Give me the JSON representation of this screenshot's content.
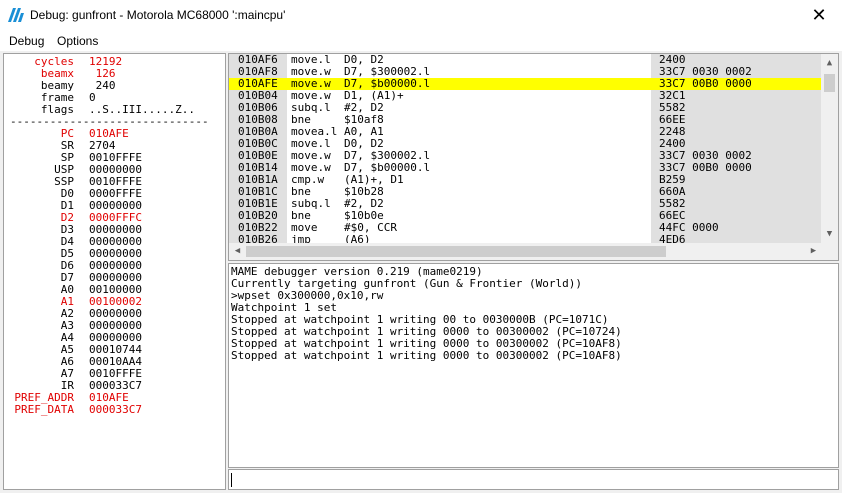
{
  "window": {
    "title": "Debug: gunfront - Motorola MC68000 ':maincpu'"
  },
  "menu": [
    "Debug",
    "Options"
  ],
  "colors": {
    "changed": "#e00000",
    "highlight": "#ffff00",
    "shade": "#e0e0e0"
  },
  "registers": [
    {
      "name": "cycles",
      "value": "12192",
      "changed": true
    },
    {
      "name": "beamx",
      "value": " 126",
      "changed": true
    },
    {
      "name": "beamy",
      "value": " 240",
      "changed": false
    },
    {
      "name": "frame",
      "value": "0",
      "changed": false
    },
    {
      "name": "flags",
      "value": "..S..III.....Z..",
      "changed": false
    },
    {
      "name": "PC",
      "value": "010AFE",
      "changed": true
    },
    {
      "name": "SR",
      "value": "2704",
      "changed": false
    },
    {
      "name": "SP",
      "value": "0010FFFE",
      "changed": false
    },
    {
      "name": "USP",
      "value": "00000000",
      "changed": false
    },
    {
      "name": "SSP",
      "value": "0010FFFE",
      "changed": false
    },
    {
      "name": "D0",
      "value": "0000FFFE",
      "changed": false
    },
    {
      "name": "D1",
      "value": "00000000",
      "changed": false
    },
    {
      "name": "D2",
      "value": "0000FFFC",
      "changed": true
    },
    {
      "name": "D3",
      "value": "00000000",
      "changed": false
    },
    {
      "name": "D4",
      "value": "00000000",
      "changed": false
    },
    {
      "name": "D5",
      "value": "00000000",
      "changed": false
    },
    {
      "name": "D6",
      "value": "00000000",
      "changed": false
    },
    {
      "name": "D7",
      "value": "00000000",
      "changed": false
    },
    {
      "name": "A0",
      "value": "00100000",
      "changed": false
    },
    {
      "name": "A1",
      "value": "00100002",
      "changed": true
    },
    {
      "name": "A2",
      "value": "00000000",
      "changed": false
    },
    {
      "name": "A3",
      "value": "00000000",
      "changed": false
    },
    {
      "name": "A4",
      "value": "00000000",
      "changed": false
    },
    {
      "name": "A5",
      "value": "00010744",
      "changed": false
    },
    {
      "name": "A6",
      "value": "00010AA4",
      "changed": false
    },
    {
      "name": "A7",
      "value": "0010FFFE",
      "changed": false
    },
    {
      "name": "IR",
      "value": "000033C7",
      "changed": false
    },
    {
      "name": "PREF_ADDR",
      "value": "010AFE",
      "changed": true
    },
    {
      "name": "PREF_DATA",
      "value": "000033C7",
      "changed": true
    }
  ],
  "separator": "------------------------------",
  "disassembly": [
    {
      "addr": "010AF6",
      "instr": "move.l  D0, D2",
      "bytes": "2400",
      "current": false
    },
    {
      "addr": "010AF8",
      "instr": "move.w  D7, $300002.l",
      "bytes": "33C7 0030 0002",
      "current": false
    },
    {
      "addr": "010AFE",
      "instr": "move.w  D7, $b00000.l",
      "bytes": "33C7 00B0 0000",
      "current": true
    },
    {
      "addr": "010B04",
      "instr": "move.w  D1, (A1)+",
      "bytes": "32C1",
      "current": false
    },
    {
      "addr": "010B06",
      "instr": "subq.l  #2, D2",
      "bytes": "5582",
      "current": false
    },
    {
      "addr": "010B08",
      "instr": "bne     $10af8",
      "bytes": "66EE",
      "current": false
    },
    {
      "addr": "010B0A",
      "instr": "movea.l A0, A1",
      "bytes": "2248",
      "current": false
    },
    {
      "addr": "010B0C",
      "instr": "move.l  D0, D2",
      "bytes": "2400",
      "current": false
    },
    {
      "addr": "010B0E",
      "instr": "move.w  D7, $300002.l",
      "bytes": "33C7 0030 0002",
      "current": false
    },
    {
      "addr": "010B14",
      "instr": "move.w  D7, $b00000.l",
      "bytes": "33C7 00B0 0000",
      "current": false
    },
    {
      "addr": "010B1A",
      "instr": "cmp.w   (A1)+, D1",
      "bytes": "B259",
      "current": false
    },
    {
      "addr": "010B1C",
      "instr": "bne     $10b28",
      "bytes": "660A",
      "current": false
    },
    {
      "addr": "010B1E",
      "instr": "subq.l  #2, D2",
      "bytes": "5582",
      "current": false
    },
    {
      "addr": "010B20",
      "instr": "bne     $10b0e",
      "bytes": "66EC",
      "current": false
    },
    {
      "addr": "010B22",
      "instr": "move    #$0, CCR",
      "bytes": "44FC 0000",
      "current": false
    },
    {
      "addr": "010B26",
      "instr": "jmp     (A6)",
      "bytes": "4ED6",
      "current": false
    }
  ],
  "console": [
    "MAME debugger version 0.219 (mame0219)",
    "Currently targeting gunfront (Gun & Frontier (World))",
    ">wpset 0x300000,0x10,rw",
    "Watchpoint 1 set",
    "Stopped at watchpoint 1 writing 00 to 0030000B (PC=1071C)",
    "Stopped at watchpoint 1 writing 0000 to 00300002 (PC=10724)",
    "Stopped at watchpoint 1 writing 0000 to 00300002 (PC=10AF8)",
    "Stopped at watchpoint 1 writing 0000 to 00300002 (PC=10AF8)"
  ],
  "command_input": {
    "value": ""
  }
}
